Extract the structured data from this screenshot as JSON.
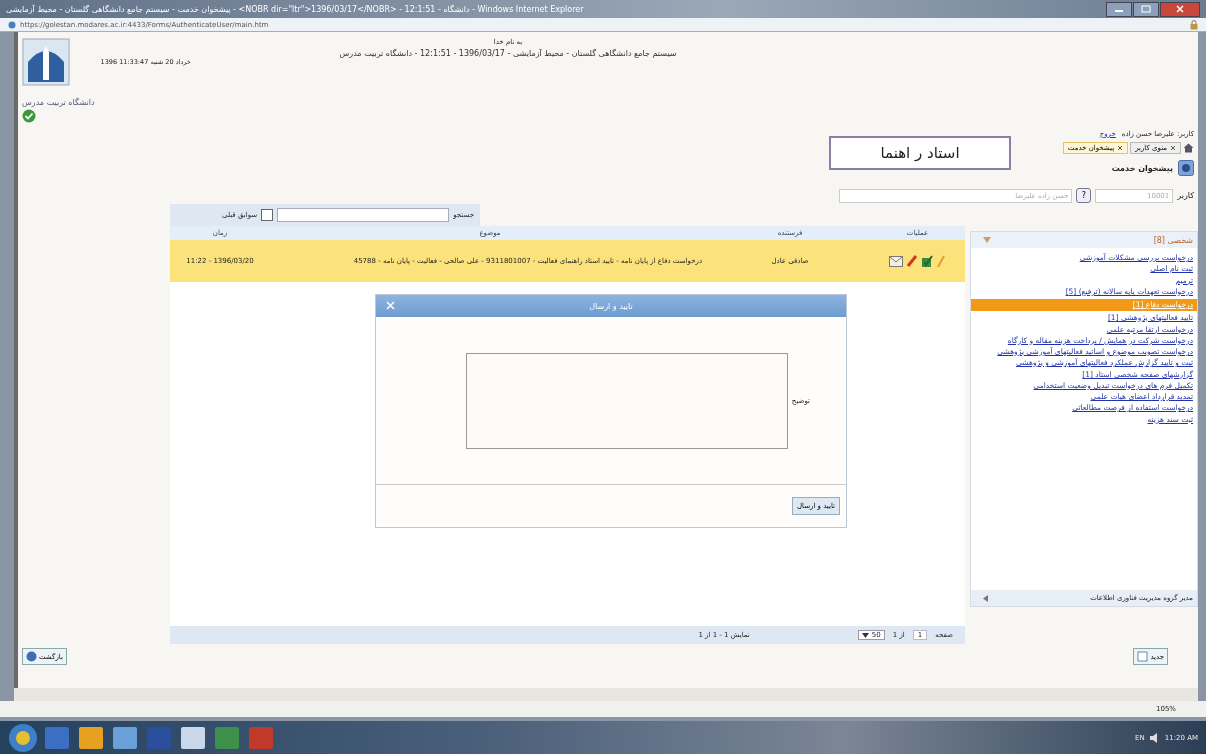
{
  "window": {
    "title": "پیشخوان خدمت - سیستم جامع دانشگاهی گلستان - محیط آزمایشی - <NOBR dir=\"ltr\">1396/03/17</NOBR> - 12:1:51 - دانشگاه - Windows Internet Explorer",
    "address": "https://golestan.modares.ac.ir:4433/Forms/AuthenticateUser/main.htm"
  },
  "header": {
    "greeting": "به نام خدا",
    "system_title": "سیستم جامع دانشگاهی گلستان - محیط آزمایشی - 1396/03/17 - 12:1:51 - دانشگاه تربیت مدرس",
    "date_time": "1396 خرداد 20 شنبه 11:33:47",
    "logo_caption": "دانشگاه تربیت مدرس",
    "user_label": "کاربر: علیرضا حسن زاده",
    "logout": "خروج"
  },
  "tabs": [
    {
      "label": "منوی کاربر",
      "selected": false
    },
    {
      "label": "پیشخوان خدمت",
      "selected": true
    }
  ],
  "callout": "استاد ر اهنما",
  "page_title": "پیشخوان خدمت",
  "user_filter": {
    "label": "کاربر",
    "code": "10001",
    "help": "?",
    "name": "حسن زاده علیرضا"
  },
  "search": {
    "label": "جستجو"
  },
  "history": {
    "label": "سوابق قبلی",
    "checked": false
  },
  "table": {
    "columns": [
      "عملیات",
      "فرستنده",
      "موضوع",
      "زمان"
    ],
    "rows": [
      {
        "selected": true,
        "sender": "صادقی عادل",
        "subject": "درخواست دفاع از پایان نامه - تایید استاد راهنمای فعالیت - 9311801007 - علی صالحی - فعالیت - پایان نامه - 45788",
        "time": "1396/03/20 - 11:22"
      }
    ]
  },
  "pager": {
    "page_label": "صفحه",
    "page": "1",
    "of": "از 1",
    "page_size": "50",
    "summary": "نمایش 1 - 1 از 1"
  },
  "dialog": {
    "title": "تایید و ارسال",
    "field_label": "توضیح",
    "button": "تایید و ارسال"
  },
  "sidebar": {
    "header": "شخصی [8]",
    "items": [
      {
        "label": "درخواست بررسی مشکلات آموزشی",
        "selected": false
      },
      {
        "label": "ثبت نام اصلی",
        "selected": false
      },
      {
        "label": "ترمیم",
        "selected": false
      },
      {
        "label": "درخواست تعهدات پایه سالانه (ترفیع) [5]",
        "selected": false
      },
      {
        "label": "درخواست دفاع [1]",
        "selected": true
      },
      {
        "label": "تایید فعالیتهای پژوهشی [1]",
        "selected": false
      },
      {
        "label": "درخواست ارتقا مرتبه علمی",
        "selected": false
      },
      {
        "label": "درخواست شرکت در همایش / پرداخت هزینه مقاله و کارگاه",
        "selected": false
      },
      {
        "label": "درخواست تصویب موضوع و اساتید فعالیتهای آموزشی پژوهشی",
        "selected": false
      },
      {
        "label": "ثبت و تایید گزارش عملکرد فعالیتهای آموزشی و پژوهشی",
        "selected": false
      },
      {
        "label": "گزارشهای صفحه شخصی استاد [1]",
        "selected": false
      },
      {
        "label": "تکمیل فرم های درخواست تبدیل وضعیت استخدامی",
        "selected": false
      },
      {
        "label": "تمدید قرارداد اعضای هیات علمی",
        "selected": false
      },
      {
        "label": "درخواست استفاده از فرصت مطالعاتی",
        "selected": false
      },
      {
        "label": "ثبت سند هزینه",
        "selected": false
      }
    ],
    "footer": "مدیر گروه مدیریت فناوری اطلاعات"
  },
  "buttons": {
    "back": "بازگشت",
    "new": "جدید"
  },
  "status_bar": {
    "zoom": "105%"
  },
  "taskbar": {
    "language": "EN",
    "time": "11:20 AM"
  }
}
